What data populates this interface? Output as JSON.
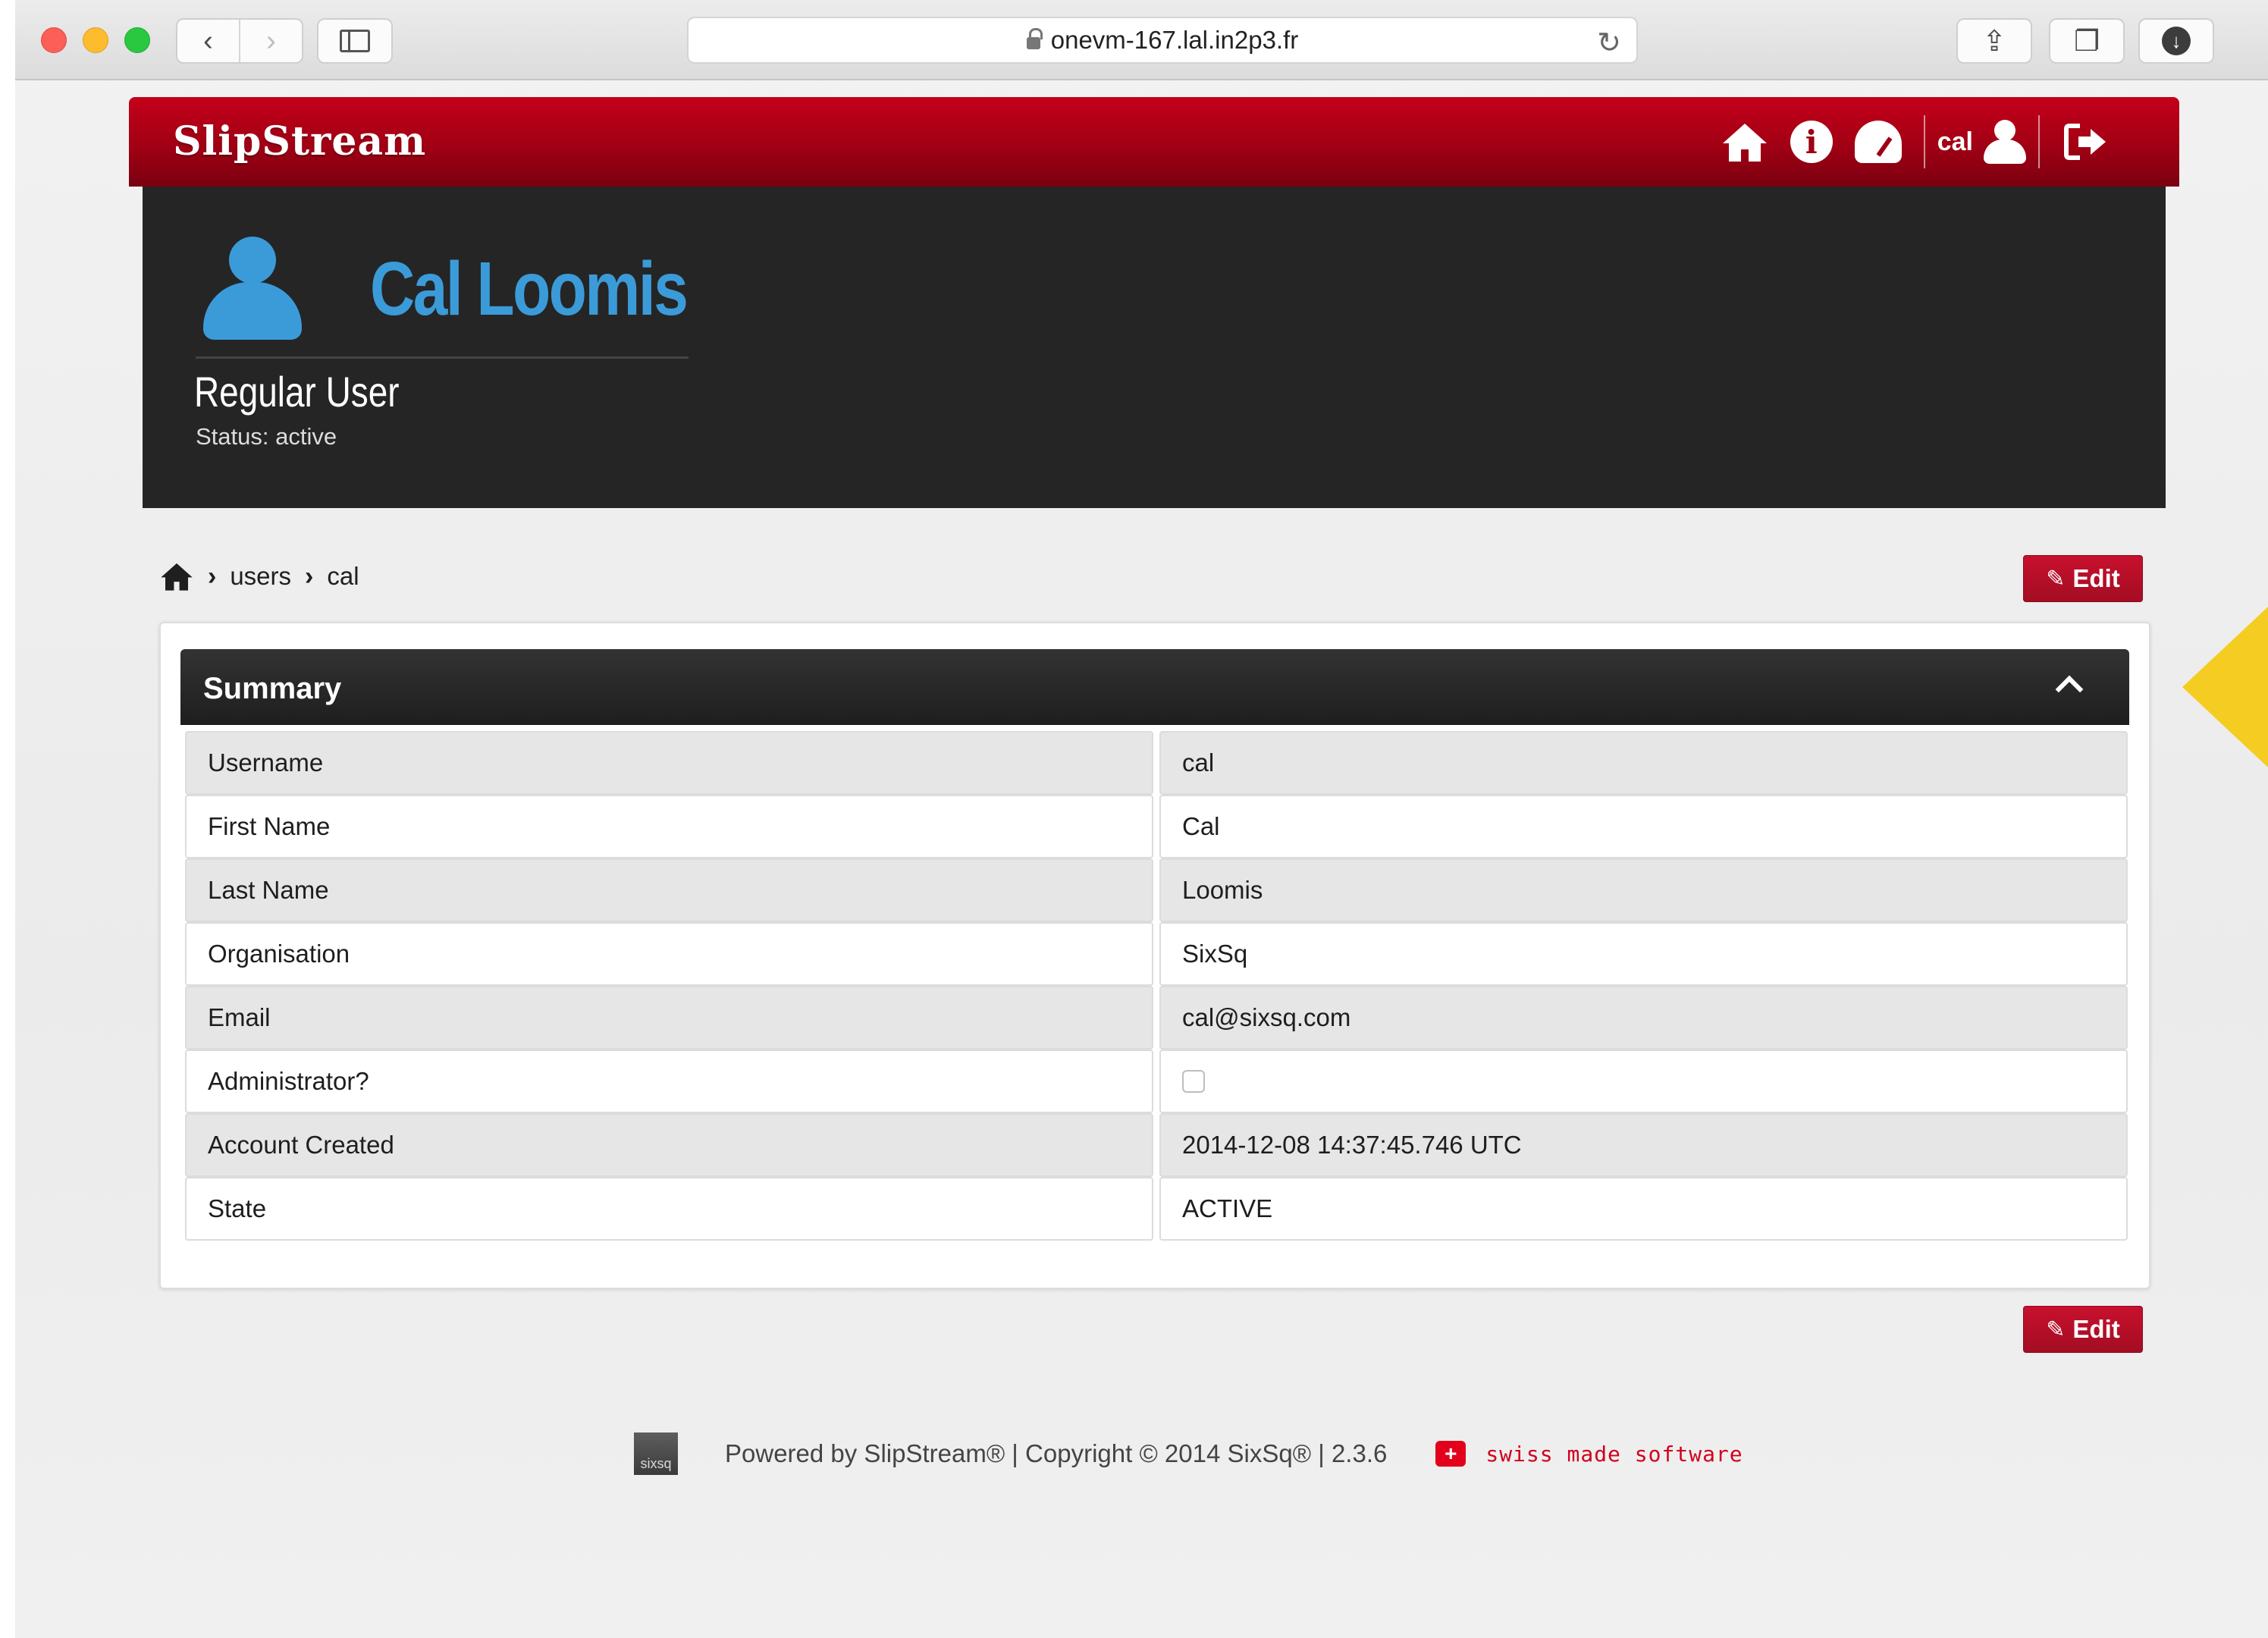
{
  "browser": {
    "url": "onevm-167.lal.in2p3.fr"
  },
  "header": {
    "brand": "SlipStream",
    "username": "cal",
    "icons": [
      "home-icon",
      "info-icon",
      "dashboard-icon",
      "user-icon",
      "logout-icon"
    ]
  },
  "profile": {
    "full_name": "Cal Loomis",
    "role": "Regular User",
    "status": "Status: active"
  },
  "breadcrumb": {
    "items": [
      "users",
      "cal"
    ]
  },
  "actions": {
    "edit_label": "Edit"
  },
  "summary": {
    "title": "Summary",
    "rows": [
      {
        "label": "Username",
        "value": "cal"
      },
      {
        "label": "First Name",
        "value": "Cal"
      },
      {
        "label": "Last Name",
        "value": "Loomis"
      },
      {
        "label": "Organisation",
        "value": "SixSq"
      },
      {
        "label": "Email",
        "value": "cal@sixsq.com"
      },
      {
        "label": "Administrator?",
        "value": "",
        "checkbox": true,
        "checked": false
      },
      {
        "label": "Account Created",
        "value": "2014-12-08 14:37:45.746 UTC"
      },
      {
        "label": "State",
        "value": "ACTIVE"
      }
    ]
  },
  "footer": {
    "logo_text": "sixsq",
    "text": "Powered by SlipStream® | Copyright © 2014 SixSq® | 2.3.6",
    "swiss": "swiss made software"
  },
  "colors": {
    "brand_red": "#a10014",
    "accent_blue": "#3b9bd9",
    "callout_yellow": "#f5cd22"
  }
}
